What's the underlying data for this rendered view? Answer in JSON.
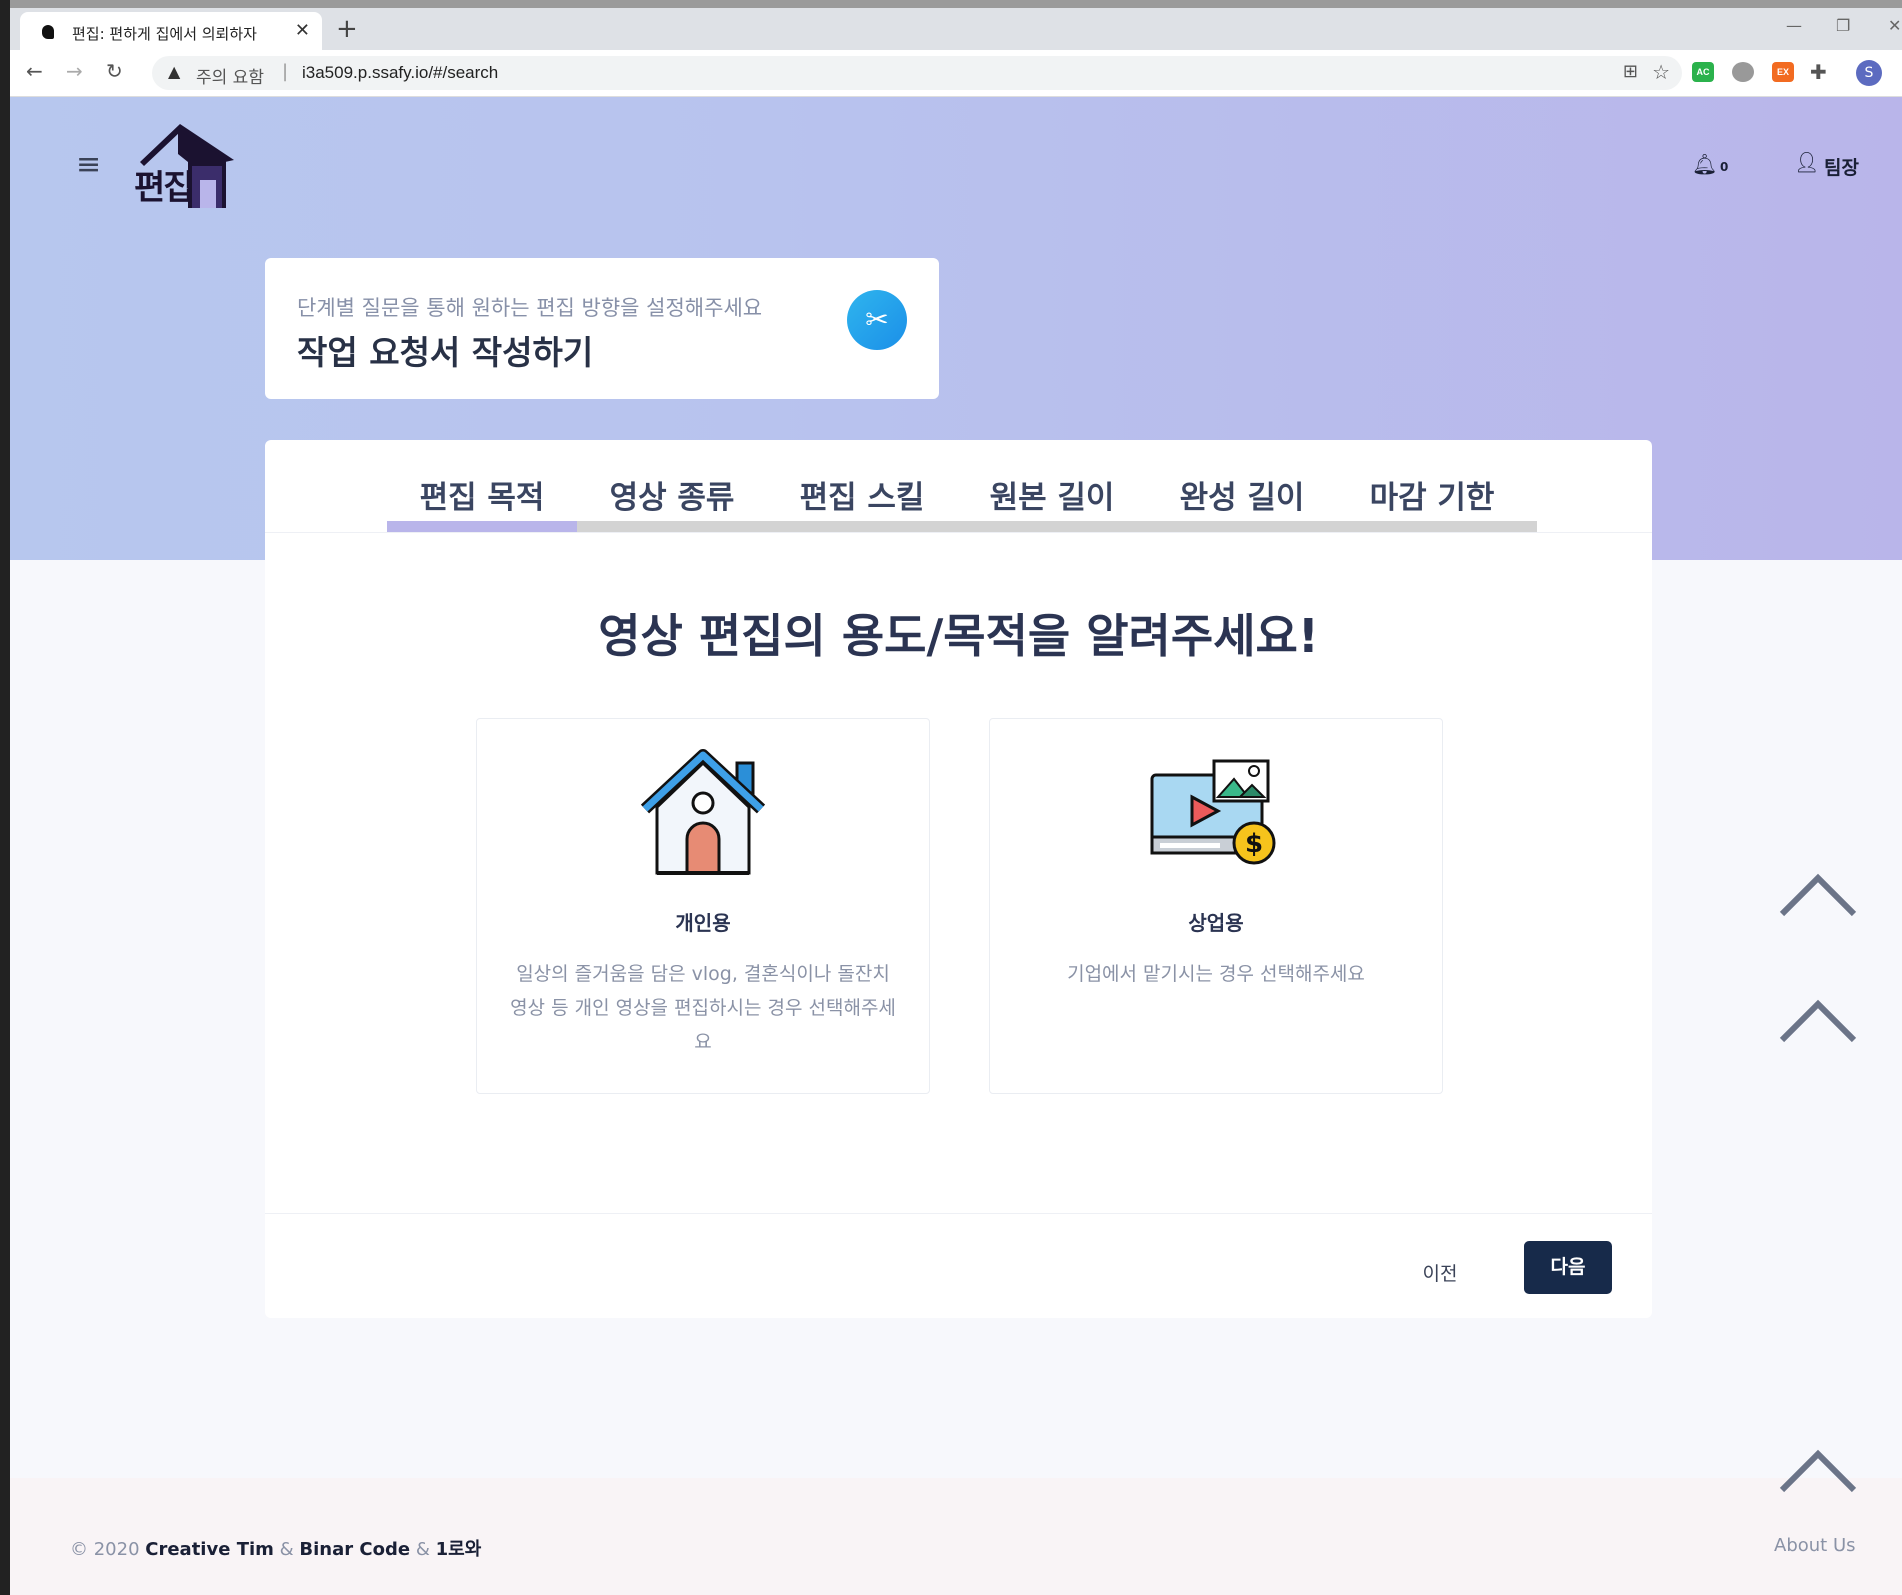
{
  "browser": {
    "tab_title": "편집: 편하게 집에서 의뢰하자",
    "close_tab": "✕",
    "new_tab": "+",
    "security_label": "주의 요함",
    "url": "i3a509.p.ssafy.io/#/search",
    "profile_initial": "S",
    "ext_ac": "AC",
    "ext_ex": "EX"
  },
  "header": {
    "logo_text": "편집",
    "notification_count": "0",
    "user_name": "팀장"
  },
  "heading_card": {
    "subtitle": "단계별 질문을 통해 원하는 편집 방향을 설정해주세요",
    "title": "작업 요청서 작성하기"
  },
  "tabs": [
    {
      "label": "편집 목적",
      "active": true
    },
    {
      "label": "영상 종류",
      "active": false
    },
    {
      "label": "편집 스킬",
      "active": false
    },
    {
      "label": "원본 길이",
      "active": false
    },
    {
      "label": "완성 길이",
      "active": false
    },
    {
      "label": "마감 기한",
      "active": false
    }
  ],
  "question": "영상 편집의 용도/목적을 알려주세요!",
  "options": [
    {
      "name": "개인용",
      "description": "일상의 즐거움을 담은 vlog, 결혼식이나 돌잔치 영상 등 개인 영상을 편집하시는 경우 선택해주세요",
      "icon": "house-icon"
    },
    {
      "name": "상업용",
      "description": "기업에서 맡기시는 경우 선택해주세요",
      "icon": "video-money-icon"
    }
  ],
  "buttons": {
    "prev": "이전",
    "next": "다음"
  },
  "footer": {
    "copyright_prefix": "© 2020",
    "credit_1": "Creative Tim",
    "amp_1": "&",
    "credit_2": "Binar Code",
    "amp_2": "&",
    "credit_3": "1로와",
    "about": "About Us"
  },
  "colors": {
    "hero_gradient_start": "#b7c7ee",
    "hero_gradient_end": "#b9b5ea",
    "primary_button": "#172a4a",
    "accent_tab": "#b9b5ea",
    "scissors_circle": "#1b8fe8"
  }
}
